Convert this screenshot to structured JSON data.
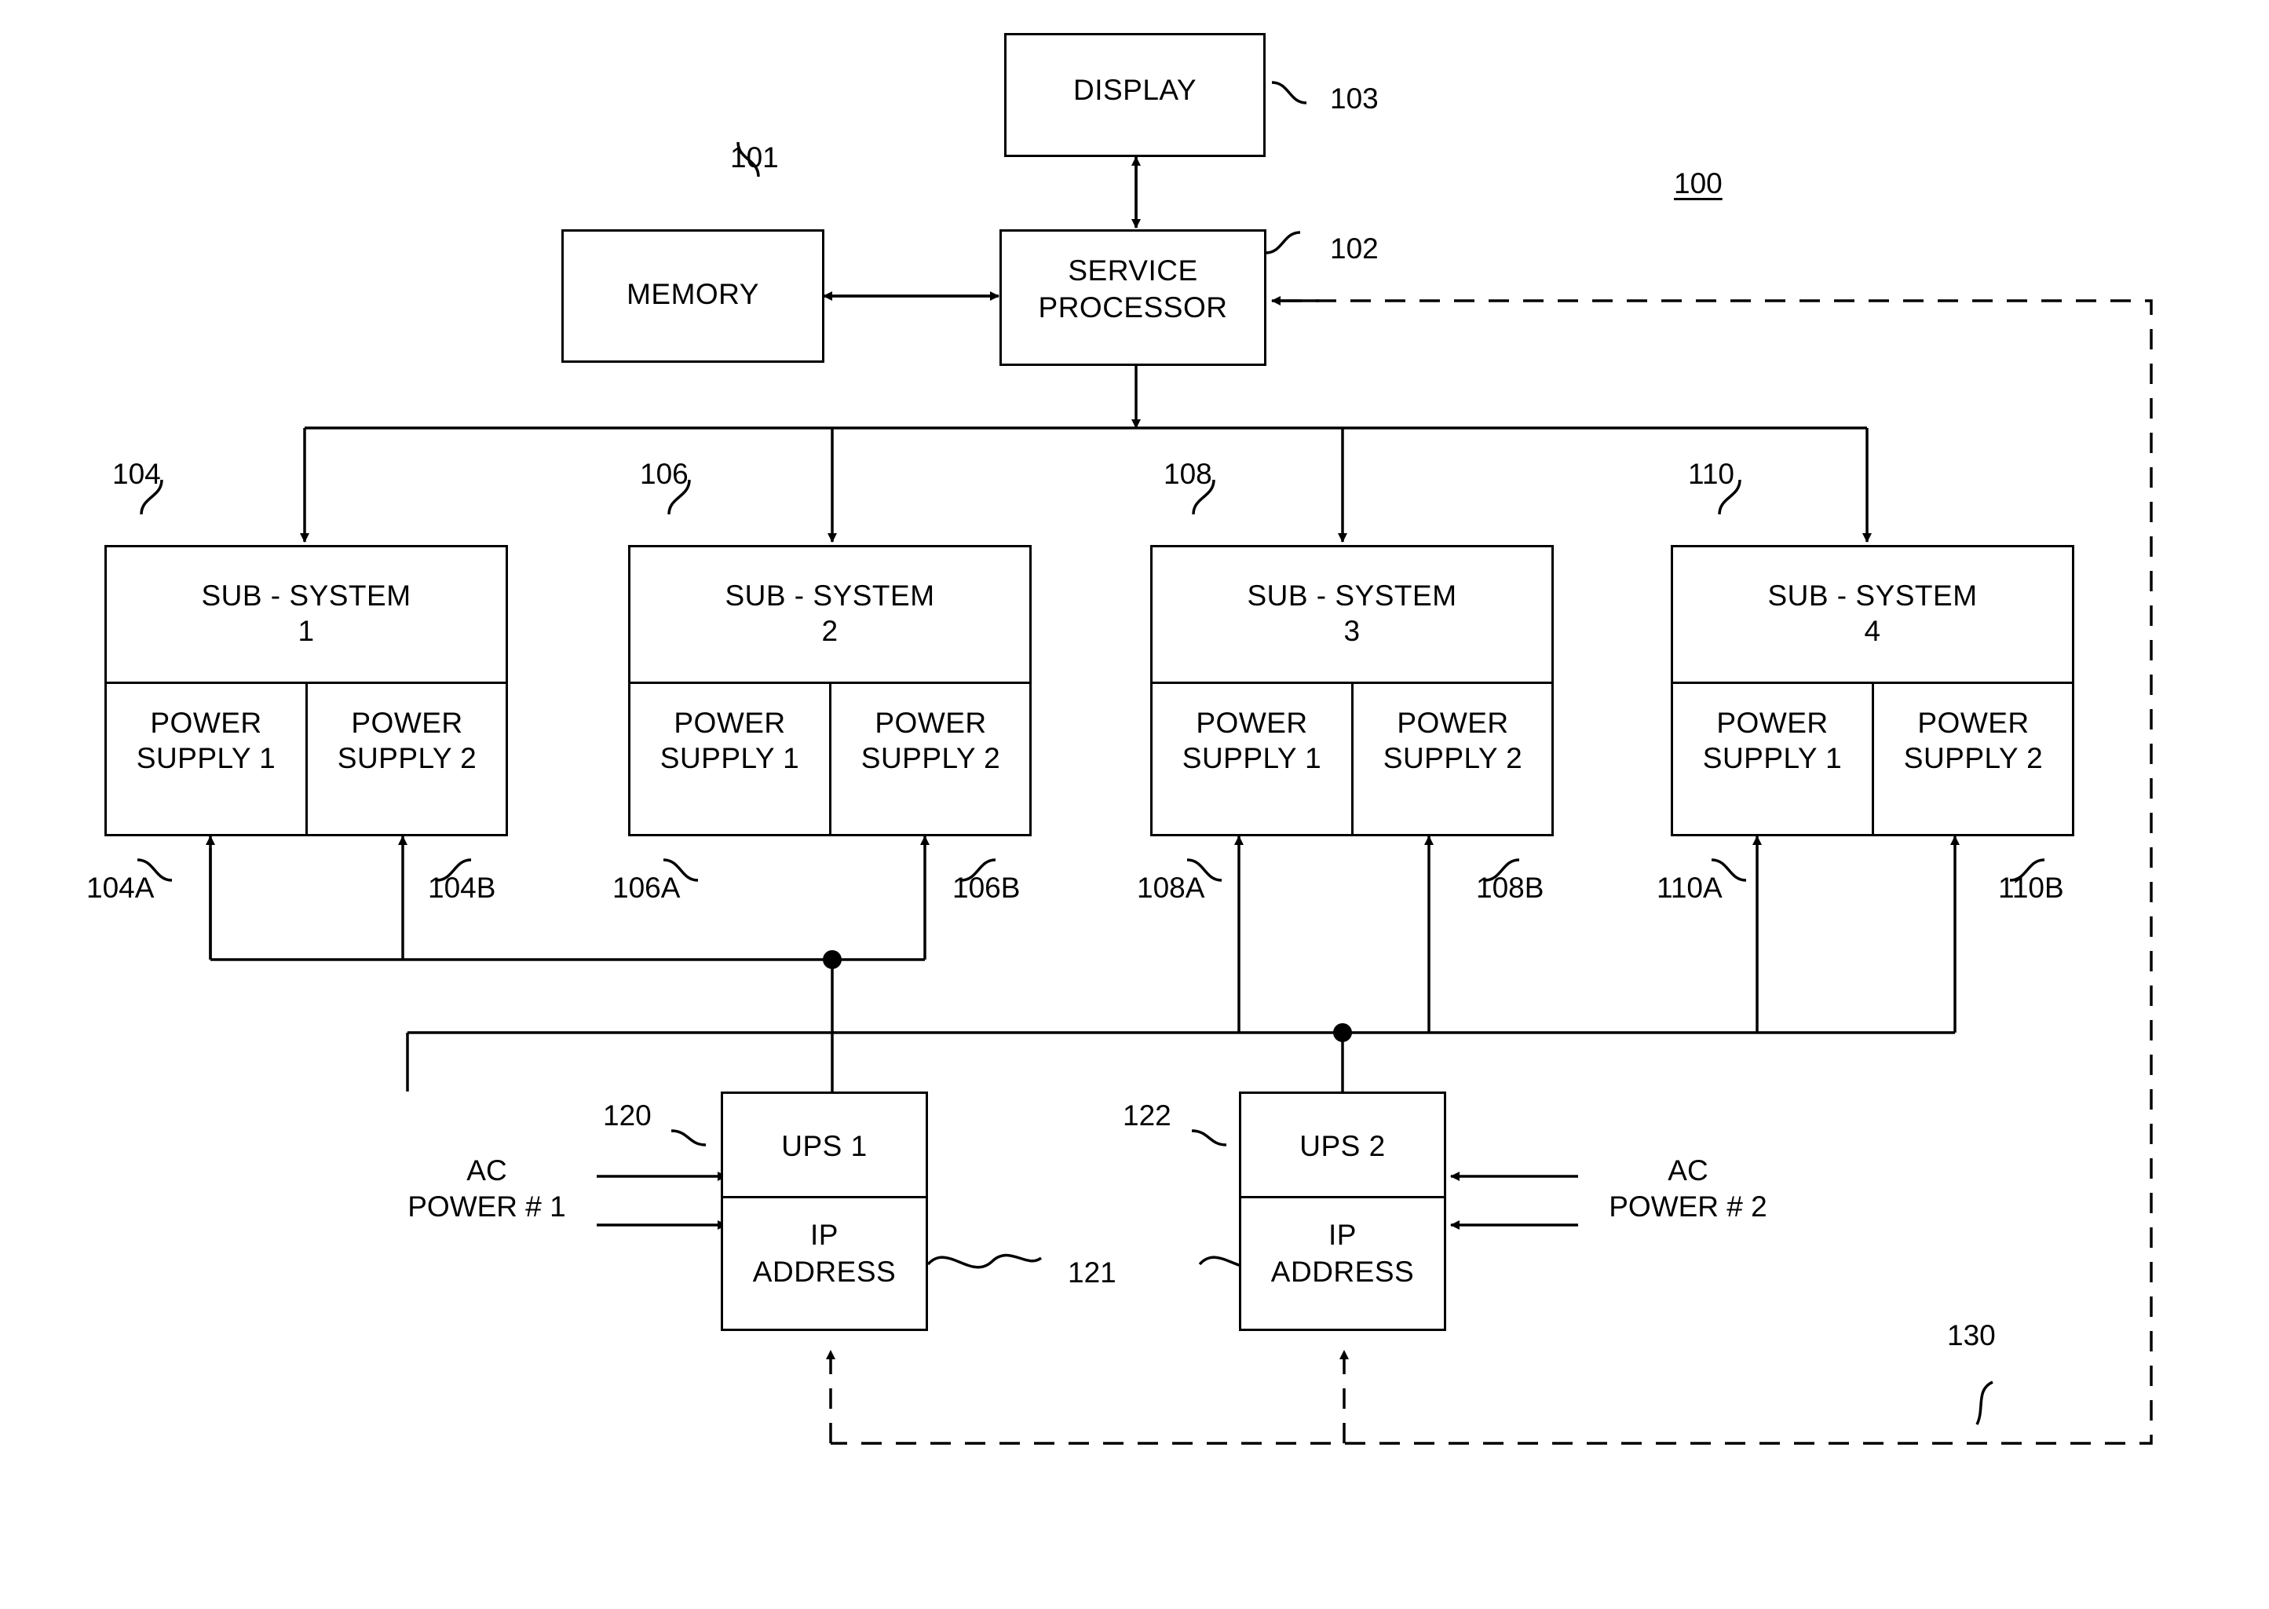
{
  "figure": {
    "figure_number": "100",
    "top_blocks": {
      "display": {
        "label": "DISPLAY",
        "ref": "103"
      },
      "memory": {
        "label": "MEMORY",
        "ref": "101"
      },
      "service_processor": {
        "label_line1": "SERVICE",
        "label_line2": "PROCESSOR",
        "ref": "102"
      }
    },
    "subsystems": [
      {
        "title_line1": "SUB - SYSTEM",
        "title_line2": "1",
        "ref": "104",
        "power_supplies": [
          {
            "line1": "POWER",
            "line2": "SUPPLY 1",
            "ref": "104A"
          },
          {
            "line1": "POWER",
            "line2": "SUPPLY 2",
            "ref": "104B"
          }
        ]
      },
      {
        "title_line1": "SUB - SYSTEM",
        "title_line2": "2",
        "ref": "106",
        "power_supplies": [
          {
            "line1": "POWER",
            "line2": "SUPPLY 1",
            "ref": "106A"
          },
          {
            "line1": "POWER",
            "line2": "SUPPLY 2",
            "ref": "106B"
          }
        ]
      },
      {
        "title_line1": "SUB - SYSTEM",
        "title_line2": "3",
        "ref": "108",
        "power_supplies": [
          {
            "line1": "POWER",
            "line2": "SUPPLY 1",
            "ref": "108A"
          },
          {
            "line1": "POWER",
            "line2": "SUPPLY 2",
            "ref": "108B"
          }
        ]
      },
      {
        "title_line1": "SUB - SYSTEM",
        "title_line2": "4",
        "ref": "110",
        "power_supplies": [
          {
            "line1": "POWER",
            "line2": "SUPPLY 1",
            "ref": "110A"
          },
          {
            "line1": "POWER",
            "line2": "SUPPLY 2",
            "ref": "110B"
          }
        ]
      }
    ],
    "ups_units": [
      {
        "title": "UPS 1",
        "ref": "120",
        "ip_line1": "IP",
        "ip_line2": "ADDRESS",
        "ac_line1": "AC",
        "ac_line2": "POWER # 1"
      },
      {
        "title": "UPS 2",
        "ref": "122",
        "ip_line1": "IP",
        "ip_line2": "ADDRESS",
        "ac_line1": "AC",
        "ac_line2": "POWER # 2"
      }
    ],
    "link_refs": {
      "ups_link": "121",
      "network_link": "130"
    }
  }
}
